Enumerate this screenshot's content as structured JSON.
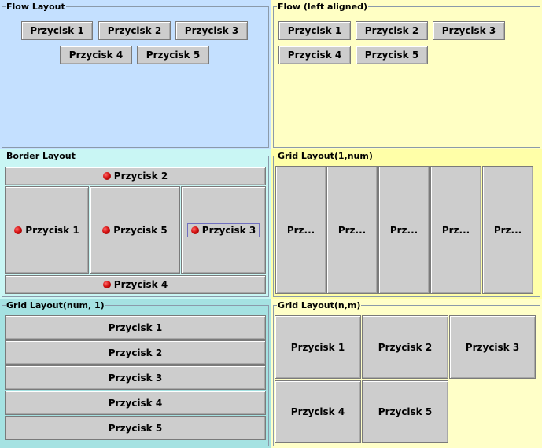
{
  "panels": {
    "flow": {
      "title": "Flow Layout",
      "buttons": [
        "Przycisk 1",
        "Przycisk 2",
        "Przycisk 3",
        "Przycisk 4",
        "Przycisk 5"
      ]
    },
    "flow_left": {
      "title": "Flow (left aligned)",
      "buttons": [
        "Przycisk 1",
        "Przycisk 2",
        "Przycisk 3",
        "Przycisk 4",
        "Przycisk 5"
      ]
    },
    "border": {
      "title": "Border Layout",
      "north": "Przycisk 2",
      "west": "Przycisk 1",
      "center": "Przycisk 5",
      "east": "Przycisk 3",
      "south": "Przycisk 4"
    },
    "grid_row": {
      "title": "Grid Layout(1,num)",
      "buttons": [
        "Prz...",
        "Prz...",
        "Prz...",
        "Prz...",
        "Prz..."
      ]
    },
    "grid_col": {
      "title": "Grid Layout(num, 1)",
      "buttons": [
        "Przycisk 1",
        "Przycisk 2",
        "Przycisk 3",
        "Przycisk 4",
        "Przycisk 5"
      ]
    },
    "grid_nm": {
      "title": "Grid Layout(n,m)",
      "buttons": [
        "Przycisk 1",
        "Przycisk 2",
        "Przycisk 3",
        "Przycisk 4",
        "Przycisk 5"
      ]
    }
  },
  "colors": {
    "flow_bg": "#c4e0ff",
    "flow_left_bg": "#ffffc4",
    "border_bg": "#c9f6f4",
    "grid_row_bg": "#ffffa8",
    "grid_col_bg": "#a5e2e2",
    "grid_nm_bg": "#ffffc8",
    "radio_dot": "#d41010"
  },
  "icons": {
    "radio": "red-dot-icon"
  }
}
